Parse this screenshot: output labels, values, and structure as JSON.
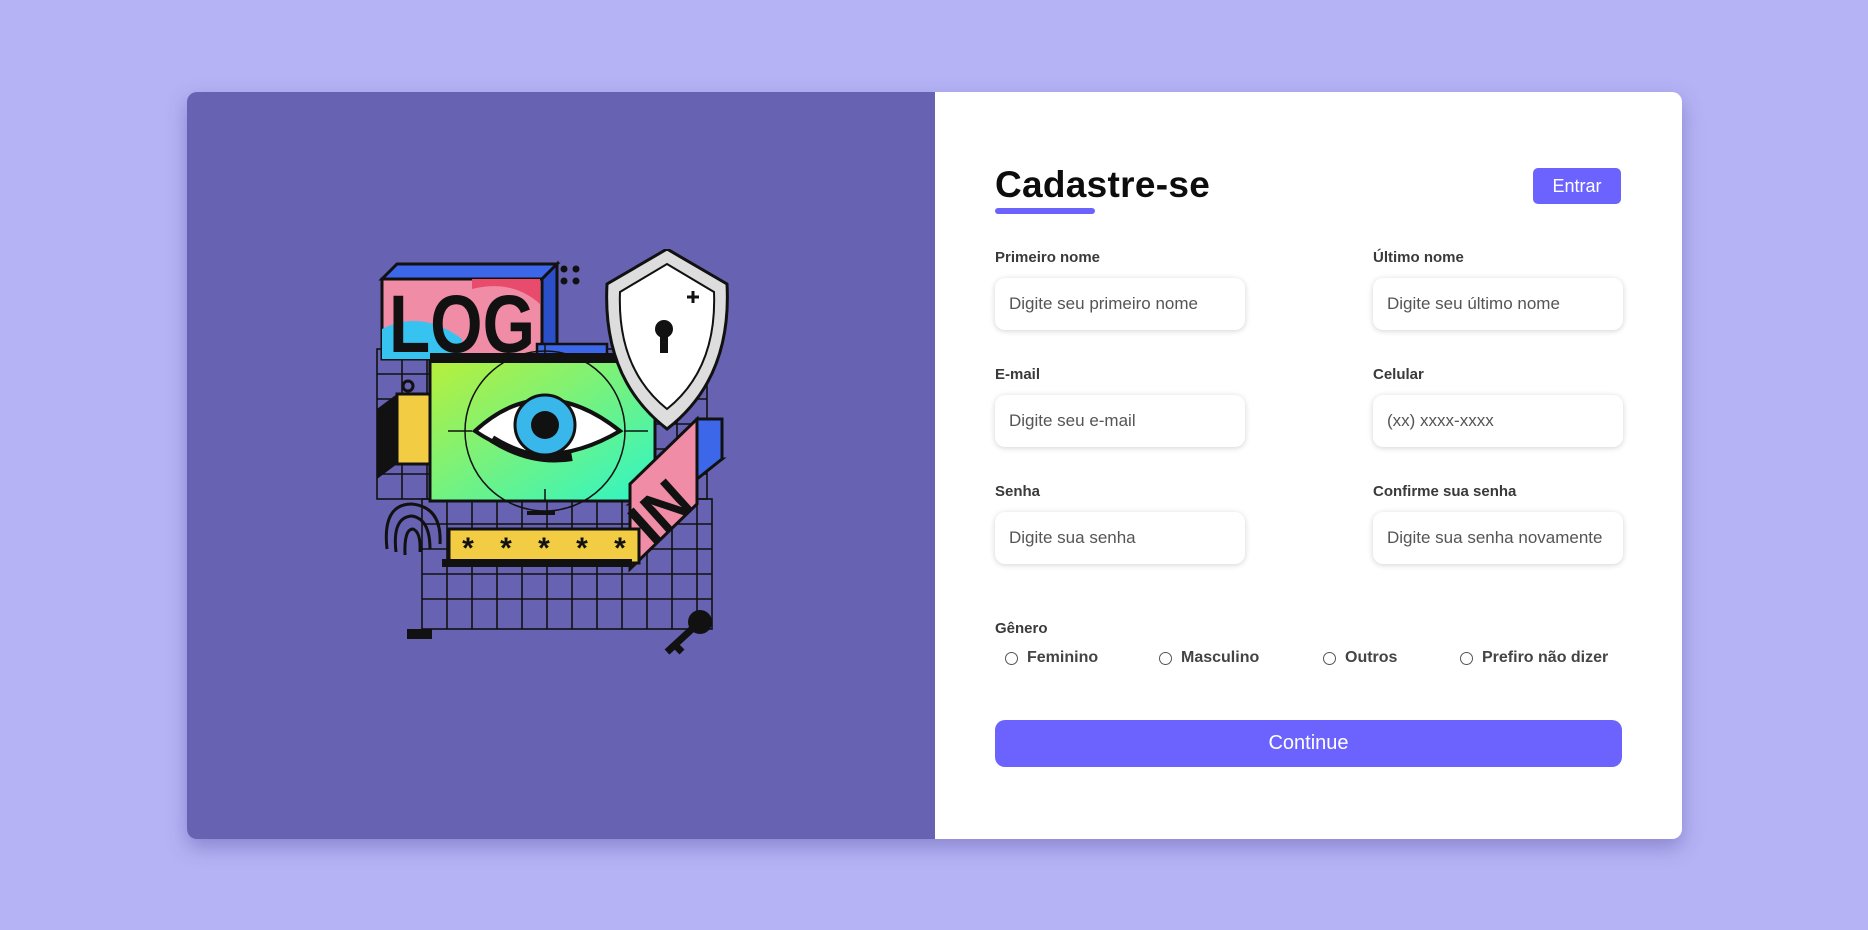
{
  "illustration": {
    "left_label": "LOG",
    "right_label": "IN",
    "password_mask": "* * * * *"
  },
  "header": {
    "title": "Cadastre-se",
    "login_button": "Entrar"
  },
  "fields": {
    "first_name": {
      "label": "Primeiro nome",
      "placeholder": "Digite seu primeiro nome"
    },
    "last_name": {
      "label": "Último nome",
      "placeholder": "Digite seu último nome"
    },
    "email": {
      "label": "E-mail",
      "placeholder": "Digite seu e-mail"
    },
    "phone": {
      "label": "Celular",
      "placeholder": "(xx) xxxx-xxxx"
    },
    "password": {
      "label": "Senha",
      "placeholder": "Digite sua senha"
    },
    "confirm_password": {
      "label": "Confirme sua senha",
      "placeholder": "Digite sua senha novamente"
    }
  },
  "gender": {
    "label": "Gênero",
    "options": [
      "Feminino",
      "Masculino",
      "Outros",
      "Prefiro não dizer"
    ]
  },
  "submit": {
    "label": "Continue"
  },
  "colors": {
    "page_bg": "#b5b3f5",
    "panel_bg": "#6762b1",
    "accent": "#6c63ff"
  }
}
